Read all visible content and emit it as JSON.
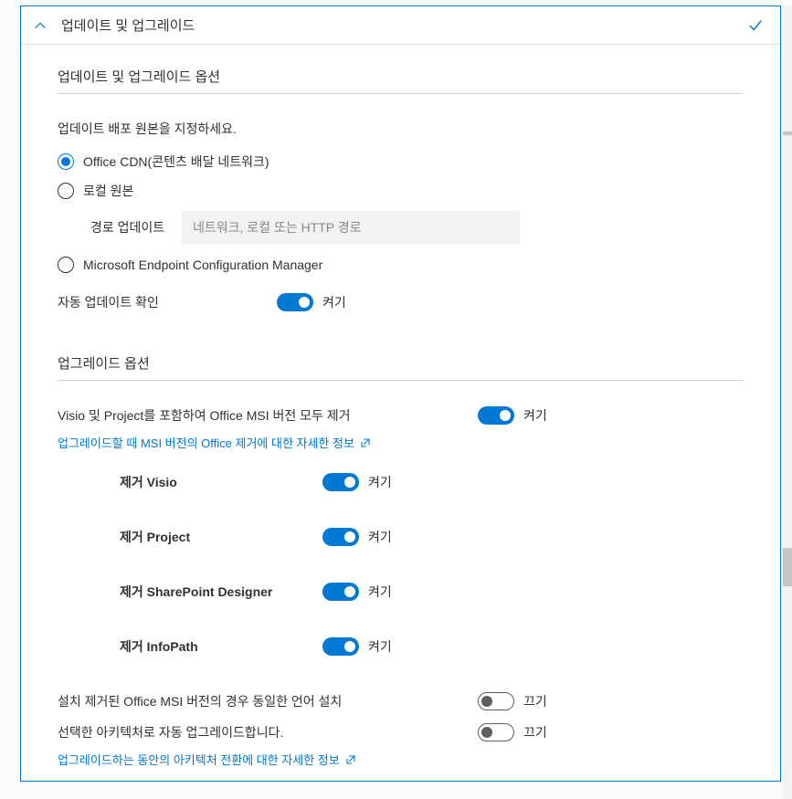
{
  "panel": {
    "title": "업데이트 및 업그레이드"
  },
  "section1": {
    "heading": "업데이트 및 업그레이드 옵션",
    "instruction": "업데이트 배포 원본을 지정하세요.",
    "radios": {
      "cdn": "Office CDN(콘텐츠 배달 네트워크)",
      "local": "로컬 원본",
      "mecm": "Microsoft Endpoint Configuration Manager"
    },
    "path_label": "경로 업데이트",
    "path_placeholder": "네트워크, 로컬 또는 HTTP 경로",
    "auto_update_label": "자동 업데이트 확인"
  },
  "section2": {
    "heading": "업그레이드 옵션",
    "remove_msi_label": "Visio 및 Project를 포함하여 Office MSI 버전 모두 제거",
    "msi_link": "업그레이드할 때 MSI 버전의 Office 제거에 대한 자세한 정보",
    "remove_visio": "제거 Visio",
    "remove_project": "제거 Project",
    "remove_spd": "제거 SharePoint Designer",
    "remove_infopath": "제거 InfoPath",
    "same_lang_label": "설치 제거된 Office MSI 버전의 경우 동일한 언어 설치",
    "auto_arch_label": "선택한 아키텍처로 자동 업그레이드합니다.",
    "arch_link": "업그레이드하는 동안의 아키텍처 전환에 대한 자세한 정보"
  },
  "toggle_text": {
    "on": "켜기",
    "off": "끄기"
  }
}
